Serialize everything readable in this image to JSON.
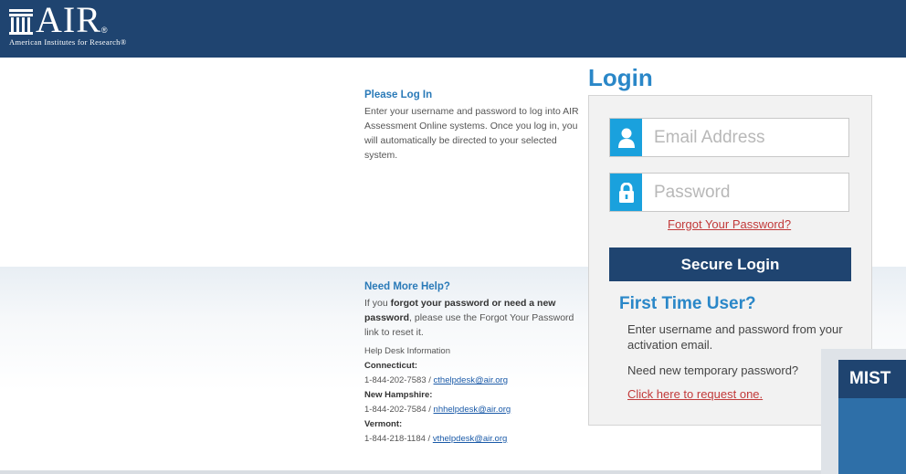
{
  "header": {
    "logo_text": "AIR",
    "logo_reg": "®",
    "logo_subtitle": "American Institutes for Research®",
    "bg_color": "#1f4470"
  },
  "please_log_in": {
    "heading": "Please Log In",
    "body": "Enter your username and password to log into AIR Assessment Online systems. Once you log in, you will automatically be directed to your selected system."
  },
  "need_help": {
    "heading": "Need More Help?",
    "intro_pre": "If you ",
    "intro_bold": "forgot your password or need a new password",
    "intro_post": ", please use the Forgot Your Password link to reset it.",
    "helpdesk_label": "Help Desk Information",
    "states": [
      {
        "name": "Connecticut:",
        "phone": "1-844-202-7583 / ",
        "email": "cthelpdesk@air.org"
      },
      {
        "name": "New Hampshire:",
        "phone": "1-844-202-7584 / ",
        "email": "nhhelpdesk@air.org"
      },
      {
        "name": "Vermont:",
        "phone": "1-844-218-1184 / ",
        "email": "vthelpdesk@air.org"
      }
    ]
  },
  "login": {
    "title": "Login",
    "email_placeholder": "Email Address",
    "email_icon": "user-icon",
    "password_placeholder": "Password",
    "password_icon": "lock-icon",
    "forgot_link": "Forgot Your Password?",
    "secure_button": "Secure Login",
    "accent_color": "#1aa1dd"
  },
  "first_time": {
    "title": "First Time User?",
    "text1": "Enter username and password from your activation email.",
    "text2": "Need new temporary password?",
    "link": "Click here to request one."
  },
  "overlay": {
    "text": "MIST"
  }
}
